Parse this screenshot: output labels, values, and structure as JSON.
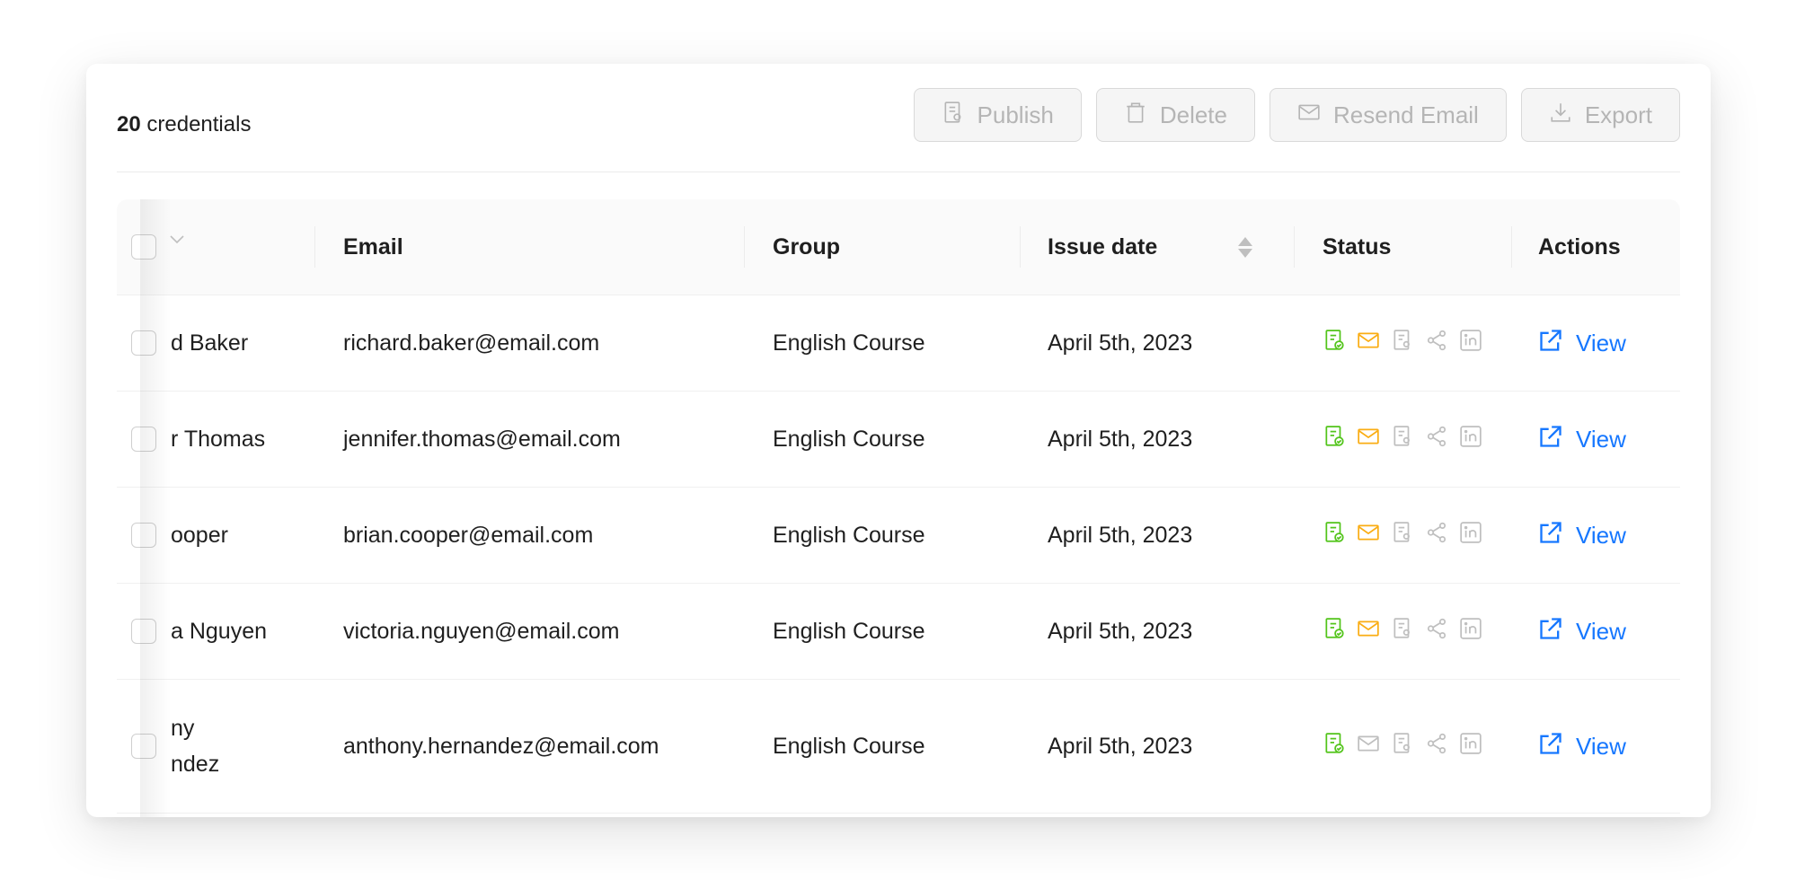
{
  "header": {
    "count_number": "20",
    "count_label": "credentials"
  },
  "toolbar": {
    "publish": "Publish",
    "delete": "Delete",
    "resend_email": "Resend Email",
    "export": "Export"
  },
  "table": {
    "columns": [
      "Email",
      "Group",
      "Issue date",
      "Status",
      "Actions"
    ],
    "rows": [
      {
        "name": "d Baker",
        "email": "richard.baker@email.com",
        "group": "English Course",
        "date": "April 5th, 2023",
        "action": "View"
      },
      {
        "name": "r Thomas",
        "email": "jennifer.thomas@email.com",
        "group": "English Course",
        "date": "April 5th, 2023",
        "action": "View"
      },
      {
        "name": "ooper",
        "email": "brian.cooper@email.com",
        "group": "English Course",
        "date": "April 5th, 2023",
        "action": "View"
      },
      {
        "name": "a Nguyen",
        "email": "victoria.nguyen@email.com",
        "group": "English Course",
        "date": "April 5th, 2023",
        "action": "View"
      },
      {
        "name_line1": "ny",
        "name_line2": "ndez",
        "email": "anthony.hernandez@email.com",
        "group": "English Course",
        "date": "April 5th, 2023",
        "action": "View"
      }
    ]
  },
  "colors": {
    "accent_blue": "#1677ff",
    "status_green": "#52c41a",
    "status_orange": "#faad14",
    "status_gray": "#bfbfbf"
  },
  "status_icons": [
    "certificate-icon",
    "mail-icon",
    "document-icon",
    "share-icon",
    "linkedin-icon"
  ]
}
